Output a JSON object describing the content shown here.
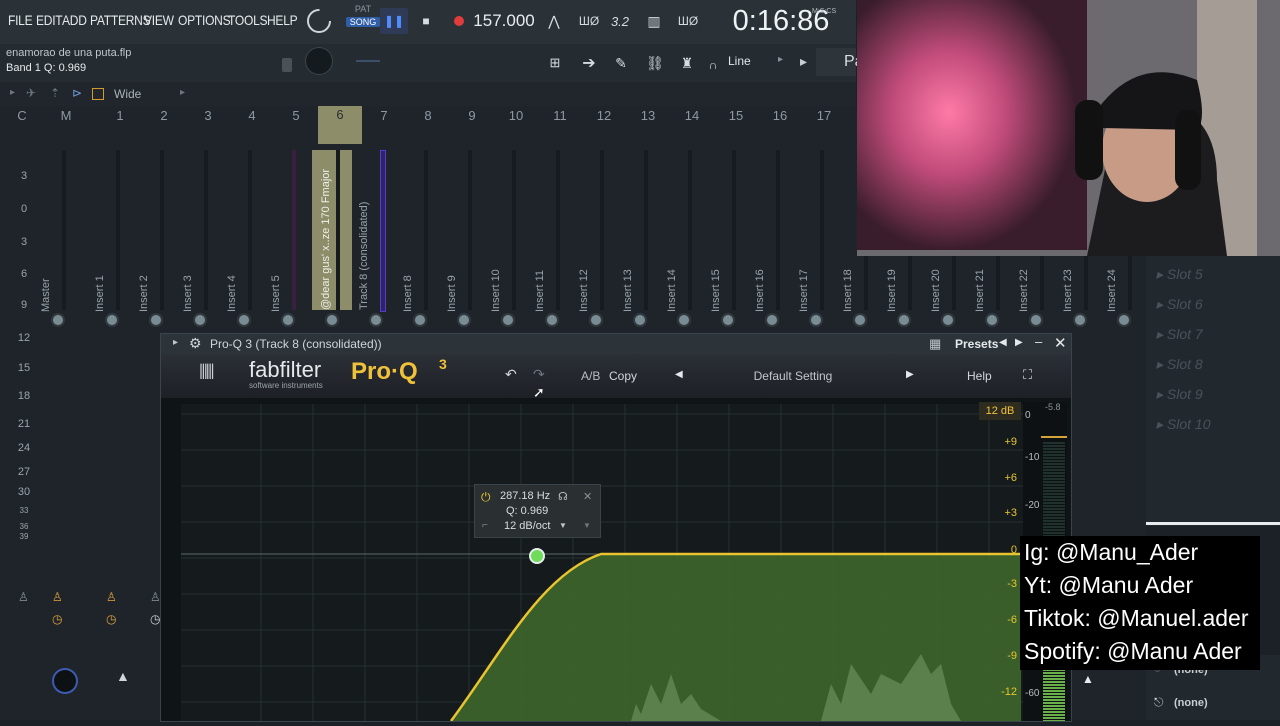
{
  "menu": {
    "items": [
      "FILE",
      "EDIT",
      "ADD",
      "PATTERNS",
      "VIEW",
      "OPTIONS",
      "TOOLS",
      "HELP"
    ],
    "pat_label": "PAT",
    "song_label": "SONG",
    "tempo": "157.000",
    "time": "0:16:86",
    "time_unit": "M:S:CS",
    "file_name": "enamorao de una puta.flp",
    "hint": "Band 1 Q: 0.969",
    "snap": "Line",
    "pat_cut": "Pa",
    "wide": "Wide"
  },
  "mixer": {
    "columns": [
      "C",
      "M",
      "1",
      "2",
      "3",
      "4",
      "5",
      "6",
      "7",
      "8",
      "9",
      "10",
      "11",
      "12",
      "13",
      "14",
      "15",
      "16",
      "17"
    ],
    "db_scale": [
      "3",
      "0",
      "3",
      "6",
      "9",
      "12",
      "15",
      "18",
      "21",
      "24",
      "27",
      "30",
      "33",
      "36",
      "39"
    ],
    "strips": [
      "Master",
      "Insert 1",
      "Insert 2",
      "Insert 3",
      "Insert 4",
      "Insert 5",
      "@dear gus' x..ze 170 Fmajor",
      "Track 8 (consolidated)",
      "Insert 8",
      "Insert 9",
      "Insert 10",
      "Insert 11",
      "Insert 12",
      "Insert 13",
      "Insert 14",
      "Insert 15",
      "Insert 16",
      "Insert 17",
      "Insert 18",
      "Insert 19",
      "Insert 20",
      "Insert 21",
      "Insert 22",
      "Insert 23",
      "Insert 24"
    ],
    "slots": [
      "Slot 5",
      "Slot 6",
      "Slot 7",
      "Slot 8",
      "Slot 9",
      "Slot 10"
    ],
    "sends": [
      "(none)",
      "(none)"
    ]
  },
  "plugin": {
    "title": "Pro-Q 3 (Track 8 (consolidated))",
    "presets_label": "Presets",
    "brand": "fabfilter",
    "brand_sub": "software instruments",
    "product": "Pro·Q",
    "product_version": "3",
    "ab_label": "A/B",
    "copy_label": "Copy",
    "preset_name": "Default Setting",
    "help_label": "Help",
    "range_label": "12 dB",
    "gain_scale": [
      "+9",
      "+6",
      "+3",
      "0",
      "-3",
      "-6",
      "-9",
      "-12"
    ],
    "meter_scale": [
      "0",
      "-10",
      "-20",
      "-60"
    ],
    "meter_peak": "-5.8",
    "band": {
      "freq": "287.18 Hz",
      "q": "Q: 0.969",
      "slope": "12 dB/oct"
    }
  },
  "overlay": {
    "lines": [
      "Ig: @Manu_Ader",
      "Yt: @Manu Ader",
      "Tiktok: @Manuel.ader",
      "Spotify: @Manu Ader"
    ]
  },
  "colors": {
    "accent": "#f0c23a",
    "eq_curve": "#e8c52e",
    "eq_fill": "#3f6b2c",
    "band_node": "#6fdc5a",
    "record": "#e03c3c",
    "insert6": "#8d8d6a",
    "purple_meter": "#5a3ad0"
  }
}
